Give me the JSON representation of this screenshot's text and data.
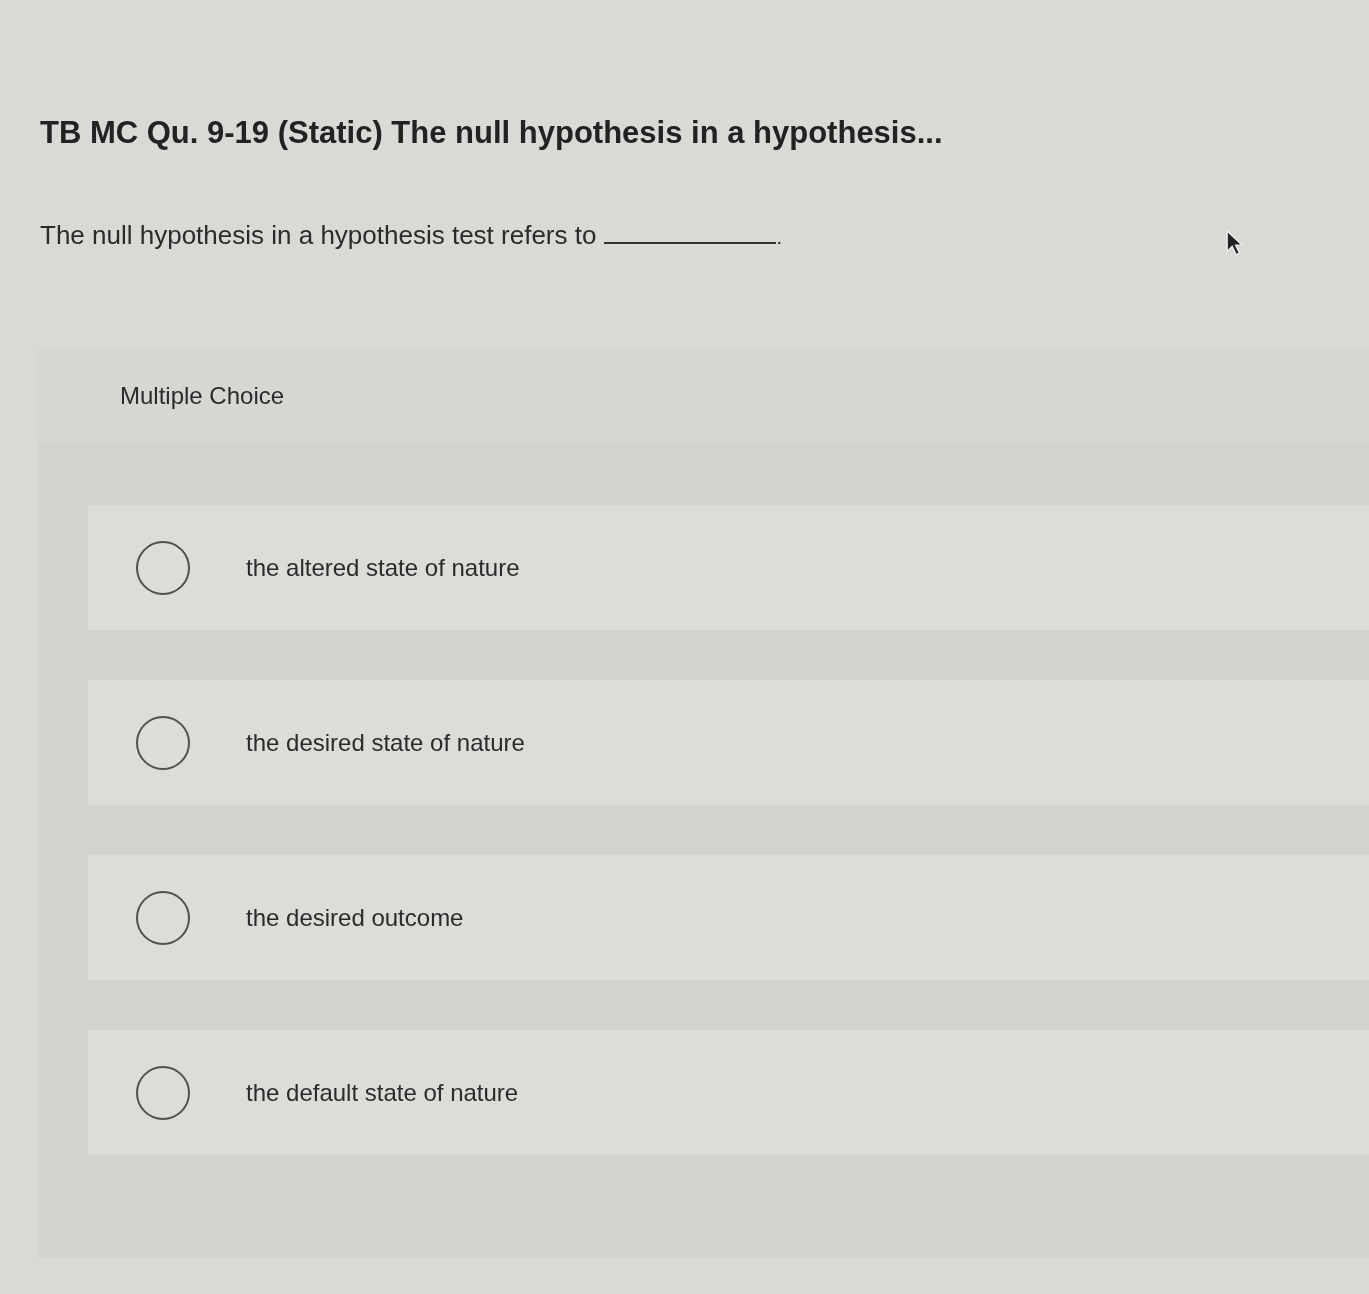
{
  "title": "TB MC Qu. 9-19 (Static) The null hypothesis in a hypothesis...",
  "question": {
    "text": "The null hypothesis in a hypothesis test refers to",
    "after_blank": "."
  },
  "panel": {
    "heading": "Multiple Choice",
    "options": [
      {
        "label": "the altered state of nature",
        "selected": false
      },
      {
        "label": "the desired state of nature",
        "selected": false
      },
      {
        "label": "the desired outcome",
        "selected": false
      },
      {
        "label": "the default state of nature",
        "selected": false
      }
    ]
  }
}
